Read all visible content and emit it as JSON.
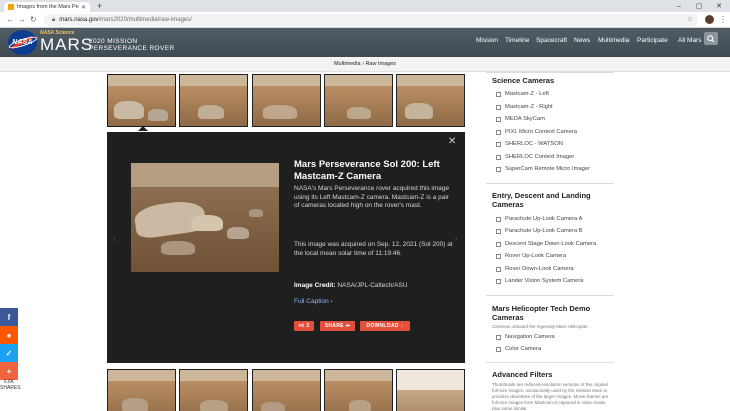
{
  "browser": {
    "tab_title": "Images from the Mars Perseverance",
    "url_domain": "mars.nasa.gov",
    "url_path": "/mars2020/multimedia/raw-images/"
  },
  "header": {
    "nasa_label": "NASA",
    "science_label": "NASA Science",
    "mars_label": "MARS",
    "sub1": "2020 MISSION",
    "sub2": "PERSEVERANCE ROVER",
    "nav": [
      "Mission",
      "Timeline",
      "Spacecraft",
      "News",
      "Multimedia",
      "Participate",
      "All Mars"
    ]
  },
  "breadcrumb": "Multimedia › Raw Images",
  "modal": {
    "title": "Mars Perseverance Sol 200: Left Mastcam-Z Camera",
    "desc": "NASA's Mars Perseverance rover acquired this image using its Left Mastcam-Z camera. Mastcam-Z is a pair of cameras located high on the rover's mast.",
    "desc2": "This image was acquired on Sep. 12, 2021 (Sol 200) at the local mean solar time of 11:19:46.",
    "credit_label": "Image Credit:",
    "credit_value": "NASA/JPL-Caltech/ASU",
    "full_caption": "Full Caption ›",
    "like_count": "3",
    "share_label": "SHARE",
    "download_label": "DOWNLOAD"
  },
  "sidebar": {
    "science_title": "Science Cameras",
    "science_items": [
      "Mastcam-Z - Left",
      "Mastcam-Z - Right",
      "MEDA SkyCam",
      "PIXL Micro Context Camera",
      "SHERLOC - WATSON",
      "SHERLOC Context Imager",
      "SuperCam Remote Micro Imager"
    ],
    "edl_title": "Entry, Descent and Landing Cameras",
    "edl_items": [
      "Parachute Up-Look Camera A",
      "Parachute Up-Look Camera B",
      "Descent Stage Down-Look Camera",
      "Rover Up-Look Camera",
      "Rover Down-Look Camera",
      "Lander Vision System Camera"
    ],
    "heli_title": "Mars Helicopter Tech Demo Cameras",
    "heli_note": "Cameras onboard the Ingenuity Mars Helicopter.",
    "heli_items": [
      "Navigation Camera",
      "Color Camera"
    ],
    "adv_title": "Advanced Filters",
    "adv_note": "Thumbnails are reduced-resolution versions of the original full-size images, occasionally used by the mission team to prioritize downlinks of the larger images. Movie frames are full-size images from Mastcam-Z captured in video mode, plus some similar"
  },
  "social": {
    "count": "6.6K",
    "count_label": "SHARES"
  },
  "colors": {
    "nasa_blue": "#0b3d91",
    "nasa_red": "#fc3d21",
    "accent_button": "#e2503c",
    "facebook": "#3b5998",
    "reddit": "#ff5700",
    "twitter": "#1da1f2",
    "more": "#f0653f"
  }
}
